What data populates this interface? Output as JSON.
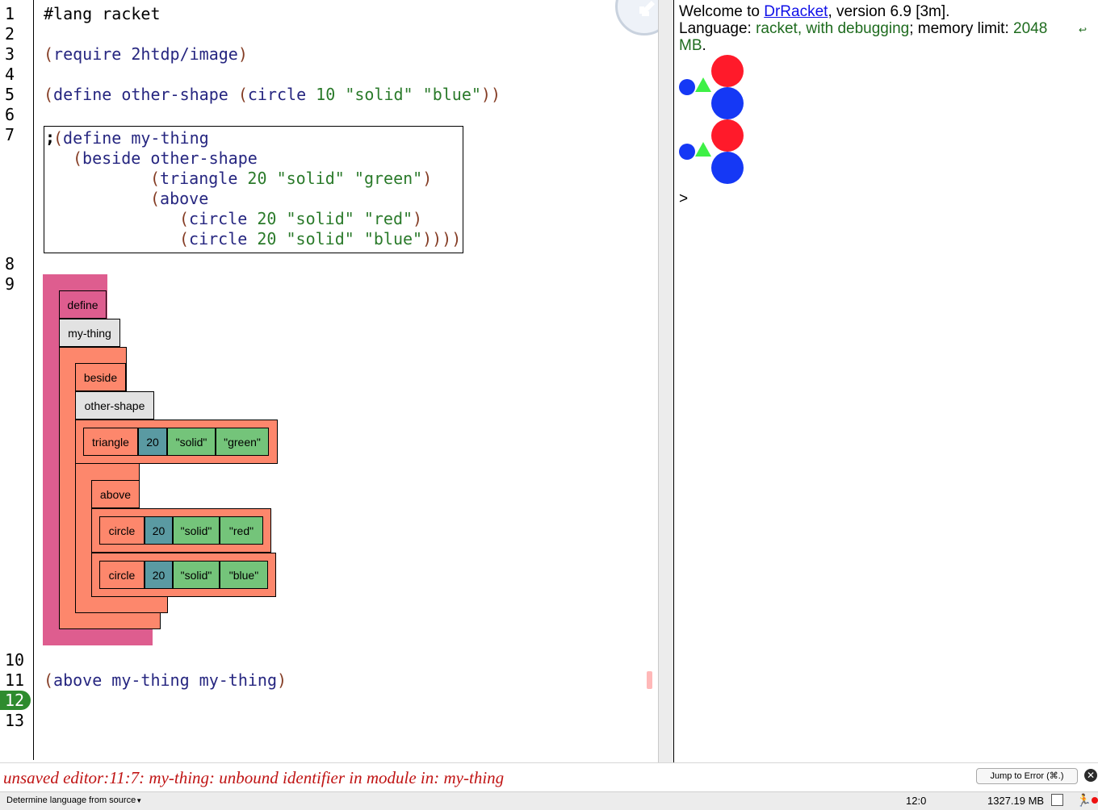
{
  "editor": {
    "line_numbers": [
      "1",
      "2",
      "3",
      "4",
      "5",
      "6",
      "7",
      "8",
      "9",
      "10",
      "11",
      "12",
      "13"
    ],
    "current_line": "12",
    "line1": "#lang racket",
    "line3": {
      "open": "(",
      "kw": "require 2htdp/image",
      "close": ")"
    },
    "line5": {
      "open": "(",
      "kw1": "define other-shape ",
      "open2": "(",
      "kw2": "circle ",
      "num": "10",
      "s1": "\"solid\"",
      "s2": "\"blue\"",
      "close": "))"
    },
    "comment_block": {
      "semi": ";",
      "l1_open": "(",
      "l1": "define my-thing",
      "l2_open": "(",
      "l2": "beside other-shape",
      "l3_open": "(",
      "l3_kw": "triangle ",
      "l3_num": "20",
      "l3_s1": "\"solid\"",
      "l3_s2": "\"green\"",
      "l3_close": ")",
      "l4_open": "(",
      "l4": "above",
      "l5_open": "(",
      "l5_kw": "circle ",
      "l5_num": "20",
      "l5_s1": "\"solid\"",
      "l5_s2": "\"red\"",
      "l5_close": ")",
      "l6_open": "(",
      "l6_kw": "circle ",
      "l6_num": "20",
      "l6_s1": "\"solid\"",
      "l6_s2": "\"blue\"",
      "l6_close": "))))"
    },
    "blocks": {
      "define": "define",
      "name": "my-thing",
      "beside": "beside",
      "other_shape": "other-shape",
      "triangle": {
        "op": "triangle",
        "num": "20",
        "s1": "\"solid\"",
        "s2": "\"green\""
      },
      "above": "above",
      "circle1": {
        "op": "circle",
        "num": "20",
        "s1": "\"solid\"",
        "s2": "\"red\""
      },
      "circle2": {
        "op": "circle",
        "num": "20",
        "s1": "\"solid\"",
        "s2": "\"blue\""
      }
    },
    "line11": {
      "open": "(",
      "kw": "above my-thing my-thing",
      "close": ")"
    }
  },
  "repl": {
    "welcome_prefix": "Welcome to ",
    "welcome_link": "DrRacket",
    "welcome_suffix": ", version 6.9 [3m].",
    "lang_label": "Language: ",
    "lang_value": "racket, with debugging",
    "mem_label": "; memory limit: ",
    "mem_value": "2048",
    "mem_unit": "MB",
    "mem_dot": ".",
    "prompt": ">"
  },
  "colors": {
    "red": "#ff1a2a",
    "blue": "#1538f5",
    "green": "#3ef046"
  },
  "error": {
    "message": "unsaved editor:11:7: my-thing: unbound identifier in module in: my-thing",
    "jump_button": "Jump to Error (⌘.)"
  },
  "status": {
    "language": "Determine language from source",
    "position": "12:0",
    "memory": "1327.19 MB"
  }
}
